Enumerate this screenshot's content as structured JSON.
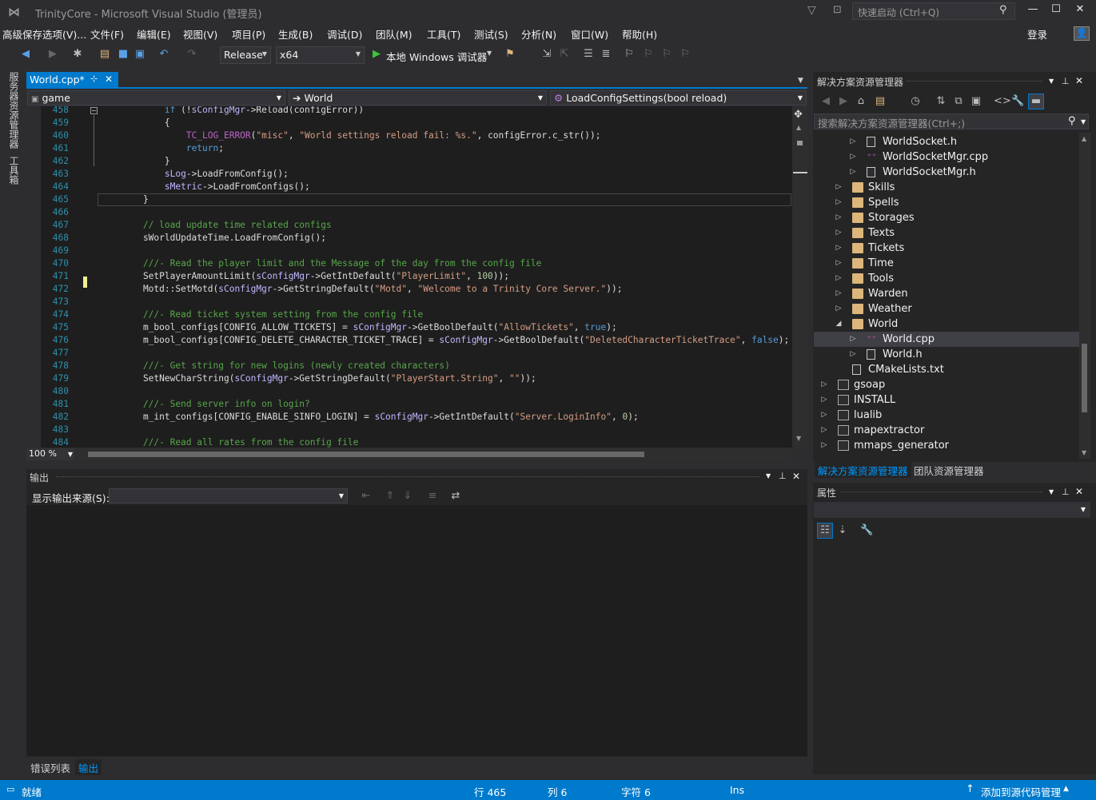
{
  "window": {
    "title": "TrinityCore - Microsoft Visual Studio (管理员)",
    "quick_launch_placeholder": "快速启动 (Ctrl+Q)",
    "sign_in": "登录"
  },
  "menu": [
    "高级保存选项(V)...",
    "文件(F)",
    "编辑(E)",
    "视图(V)",
    "项目(P)",
    "生成(B)",
    "调试(D)",
    "团队(M)",
    "工具(T)",
    "测试(S)",
    "分析(N)",
    "窗口(W)",
    "帮助(H)"
  ],
  "toolbar": {
    "config": "Release",
    "platform": "x64",
    "debug_label": "本地 Windows 调试器"
  },
  "left_strip": [
    "服务器资源管理器",
    "工具箱"
  ],
  "editor": {
    "tab_label": "World.cpp*",
    "nav_project": "game",
    "nav_class": "World",
    "nav_member": "LoadConfigSettings(bool reload)",
    "zoom": "100 %",
    "lines": [
      {
        "n": "458",
        "code": "        if (!sConfigMgr->Reload(configError))"
      },
      {
        "n": "459",
        "code": "        {"
      },
      {
        "n": "460",
        "code": "            TC_LOG_ERROR(\"misc\", \"World settings reload fail: %s.\", configError.c_str());"
      },
      {
        "n": "461",
        "code": "            return;"
      },
      {
        "n": "462",
        "code": "        }"
      },
      {
        "n": "463",
        "code": "        sLog->LoadFromConfig();"
      },
      {
        "n": "464",
        "code": "        sMetric->LoadFromConfigs();"
      },
      {
        "n": "465",
        "code": "    }"
      },
      {
        "n": "466",
        "code": ""
      },
      {
        "n": "467",
        "code": "    // load update time related configs"
      },
      {
        "n": "468",
        "code": "    sWorldUpdateTime.LoadFromConfig();"
      },
      {
        "n": "469",
        "code": ""
      },
      {
        "n": "470",
        "code": "    ///- Read the player limit and the Message of the day from the config file"
      },
      {
        "n": "471",
        "code": "    SetPlayerAmountLimit(sConfigMgr->GetIntDefault(\"PlayerLimit\", 100));"
      },
      {
        "n": "472",
        "code": "    Motd::SetMotd(sConfigMgr->GetStringDefault(\"Motd\", \"Welcome to a Trinity Core Server.\"));"
      },
      {
        "n": "473",
        "code": ""
      },
      {
        "n": "474",
        "code": "    ///- Read ticket system setting from the config file"
      },
      {
        "n": "475",
        "code": "    m_bool_configs[CONFIG_ALLOW_TICKETS] = sConfigMgr->GetBoolDefault(\"AllowTickets\", true);"
      },
      {
        "n": "476",
        "code": "    m_bool_configs[CONFIG_DELETE_CHARACTER_TICKET_TRACE] = sConfigMgr->GetBoolDefault(\"DeletedCharacterTicketTrace\", false);"
      },
      {
        "n": "477",
        "code": ""
      },
      {
        "n": "478",
        "code": "    ///- Get string for new logins (newly created characters)"
      },
      {
        "n": "479",
        "code": "    SetNewCharString(sConfigMgr->GetStringDefault(\"PlayerStart.String\", \"\"));"
      },
      {
        "n": "480",
        "code": ""
      },
      {
        "n": "481",
        "code": "    ///- Send server info on login?"
      },
      {
        "n": "482",
        "code": "    m_int_configs[CONFIG_ENABLE_SINFO_LOGIN] = sConfigMgr->GetIntDefault(\"Server.LoginInfo\", 0);"
      },
      {
        "n": "483",
        "code": ""
      },
      {
        "n": "484",
        "code": "    ///- Read all rates from the config file"
      }
    ]
  },
  "output_panel": {
    "title": "输出",
    "source_label": "显示输出来源(S):"
  },
  "bottom_tabs": [
    "错误列表",
    "输出"
  ],
  "status": {
    "ready": "就绪",
    "line": "行 465",
    "col": "列 6",
    "ch": "字符 6",
    "ins": "Ins",
    "source_control": "添加到源代码管理"
  },
  "solution_explorer": {
    "title": "解决方案资源管理器",
    "search_placeholder": "搜索解决方案资源管理器(Ctrl+;)",
    "items": [
      {
        "label": "WorldSocket.h",
        "kind": "h",
        "level": 3,
        "arrow": "collapsed"
      },
      {
        "label": "WorldSocketMgr.cpp",
        "kind": "cpp",
        "level": 3,
        "arrow": "collapsed"
      },
      {
        "label": "WorldSocketMgr.h",
        "kind": "h",
        "level": 3,
        "arrow": "collapsed"
      },
      {
        "label": "Skills",
        "kind": "folder",
        "level": 2,
        "arrow": "collapsed"
      },
      {
        "label": "Spells",
        "kind": "folder",
        "level": 2,
        "arrow": "collapsed"
      },
      {
        "label": "Storages",
        "kind": "folder",
        "level": 2,
        "arrow": "collapsed"
      },
      {
        "label": "Texts",
        "kind": "folder",
        "level": 2,
        "arrow": "collapsed"
      },
      {
        "label": "Tickets",
        "kind": "folder",
        "level": 2,
        "arrow": "collapsed"
      },
      {
        "label": "Time",
        "kind": "folder",
        "level": 2,
        "arrow": "collapsed"
      },
      {
        "label": "Tools",
        "kind": "folder",
        "level": 2,
        "arrow": "collapsed"
      },
      {
        "label": "Warden",
        "kind": "folder",
        "level": 2,
        "arrow": "collapsed"
      },
      {
        "label": "Weather",
        "kind": "folder",
        "level": 2,
        "arrow": "collapsed"
      },
      {
        "label": "World",
        "kind": "folder",
        "level": 2,
        "arrow": "expanded"
      },
      {
        "label": "World.cpp",
        "kind": "cpp",
        "level": 3,
        "arrow": "collapsed",
        "selected": true
      },
      {
        "label": "World.h",
        "kind": "h",
        "level": 3,
        "arrow": "collapsed"
      },
      {
        "label": "CMakeLists.txt",
        "kind": "txt",
        "level": 2,
        "arrow": "none"
      },
      {
        "label": "gsoap",
        "kind": "proj",
        "level": 1,
        "arrow": "collapsed"
      },
      {
        "label": "INSTALL",
        "kind": "proj",
        "level": 1,
        "arrow": "collapsed"
      },
      {
        "label": "lualib",
        "kind": "proj",
        "level": 1,
        "arrow": "collapsed"
      },
      {
        "label": "mapextractor",
        "kind": "proj",
        "level": 1,
        "arrow": "collapsed"
      },
      {
        "label": "mmaps_generator",
        "kind": "proj",
        "level": 1,
        "arrow": "collapsed"
      }
    ],
    "tabs": [
      "解决方案资源管理器",
      "团队资源管理器"
    ]
  },
  "properties": {
    "title": "属性"
  }
}
